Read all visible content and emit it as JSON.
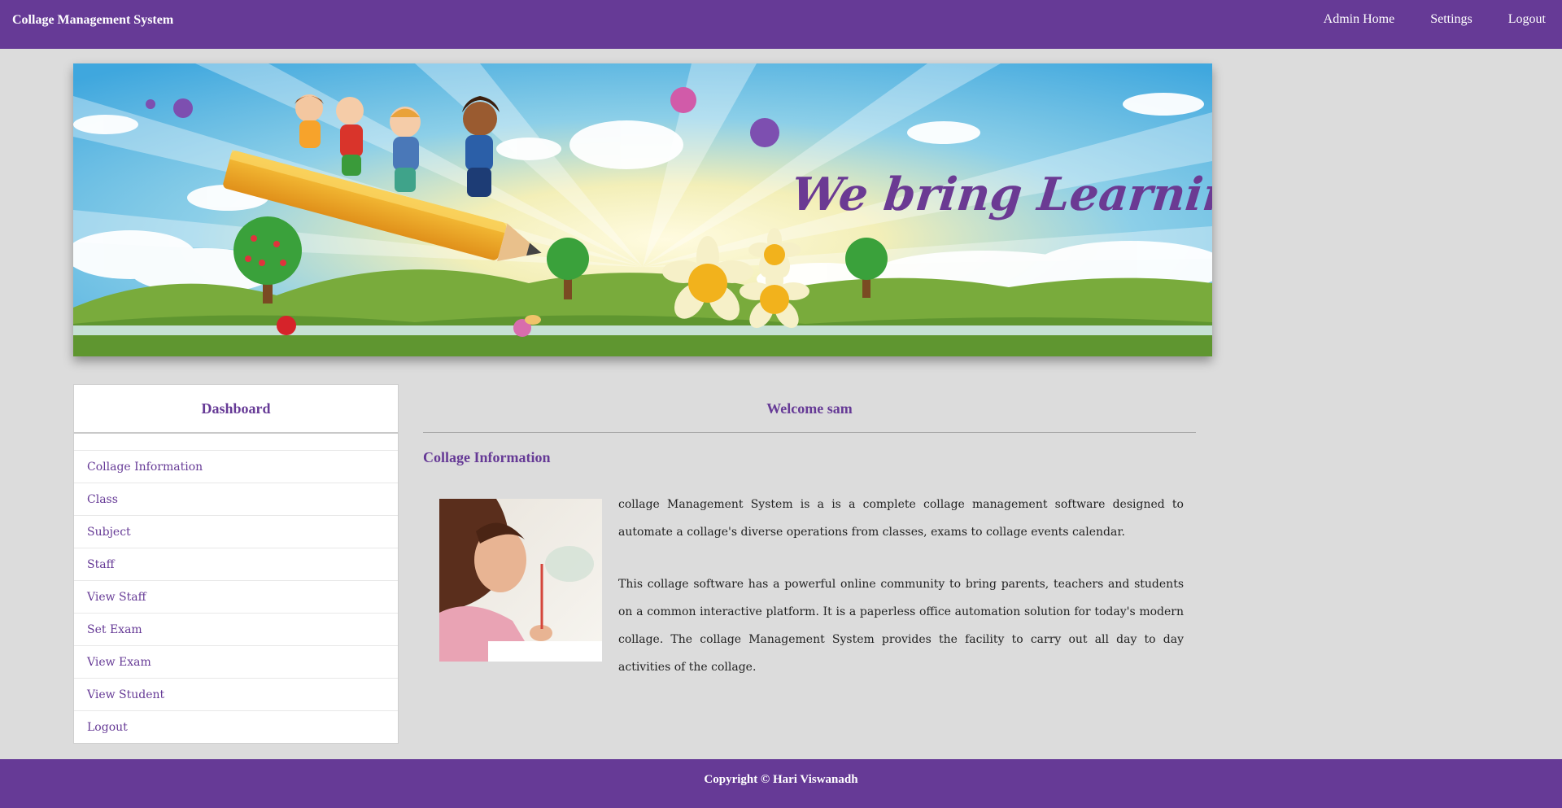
{
  "header": {
    "brand": "Collage Management System",
    "nav": [
      "Admin Home",
      "Settings",
      "Logout"
    ]
  },
  "banner": {
    "tagline": "We bring Learning to Life"
  },
  "sidebar": {
    "title": "Dashboard",
    "items": [
      "Collage Information",
      "Class",
      "Subject",
      "Staff",
      "View Staff",
      "Set Exam",
      "View Exam",
      "View Student",
      "Logout"
    ]
  },
  "main": {
    "welcome": "Welcome sam",
    "section_title": "Collage Information",
    "paragraphs": [
      "collage Management System is a is a complete collage management software designed to automate a collage's diverse operations from classes, exams to collage events calendar.",
      "This collage software has a powerful online community to bring parents, teachers and students on a common interactive platform. It is a paperless office automation solution for today's modern collage. The collage Management System provides the facility to carry out all day to day activities of the collage."
    ]
  },
  "footer": {
    "copyright": "Copyright © Hari Viswanadh"
  },
  "colors": {
    "brand_purple": "#663a96",
    "page_bg": "#dcdcdc"
  }
}
